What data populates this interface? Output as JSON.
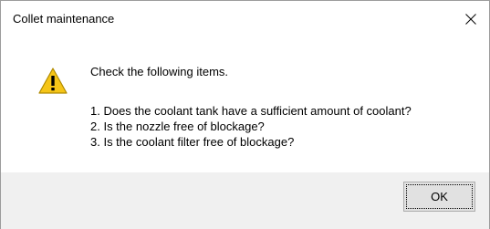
{
  "window": {
    "title": "Collet maintenance",
    "close_icon": "close-icon"
  },
  "message": {
    "icon": "warning-icon",
    "heading": "Check the following items.",
    "items": [
      "1. Does the coolant tank have a sufficient amount of coolant?",
      "2. Is the nozzle free of blockage?",
      "3. Is the coolant filter free of blockage?"
    ]
  },
  "buttons": {
    "ok_label": "OK"
  },
  "colors": {
    "warning_fill": "#f5c518",
    "footer_bg": "#f0f0f0",
    "button_bg": "#e1e1e1"
  }
}
